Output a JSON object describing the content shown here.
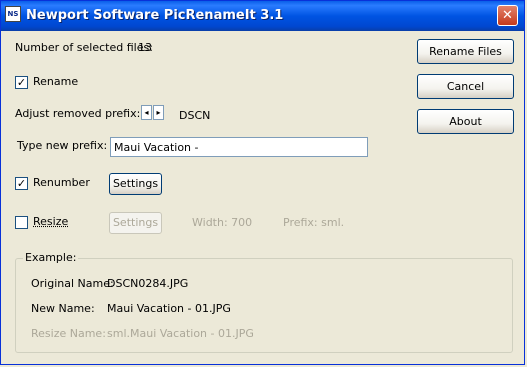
{
  "window": {
    "title": "Newport Software PicRenameIt 3.1",
    "icon_text": "NS",
    "close_glyph": "✕"
  },
  "selected": {
    "label": "Number of selected files:",
    "count": "13"
  },
  "rename": {
    "label": "Rename",
    "checked_glyph": "✓"
  },
  "prefix_adjust": {
    "label": "Adjust removed prefix:",
    "left_glyph": "◂",
    "right_glyph": "▸",
    "value": "DSCN"
  },
  "new_prefix": {
    "label": "Type new prefix:",
    "value": "Maui Vacation -"
  },
  "renumber": {
    "label": "Renumber",
    "checked_glyph": "✓",
    "settings_label": "Settings"
  },
  "resize": {
    "label": "Resize",
    "settings_label": "Settings",
    "width_text": "Width: 700",
    "prefix_text": "Prefix: sml."
  },
  "buttons": {
    "rename_files": "Rename Files",
    "cancel": "Cancel",
    "about": "About"
  },
  "example": {
    "title": "Example:",
    "original_label": "Original Name:",
    "original_value": "DSCN0284.JPG",
    "new_label": "New Name:",
    "new_value": "Maui Vacation - 01.JPG",
    "resize_label": "Resize Name:",
    "resize_value": "sml.Maui Vacation - 01.JPG"
  }
}
